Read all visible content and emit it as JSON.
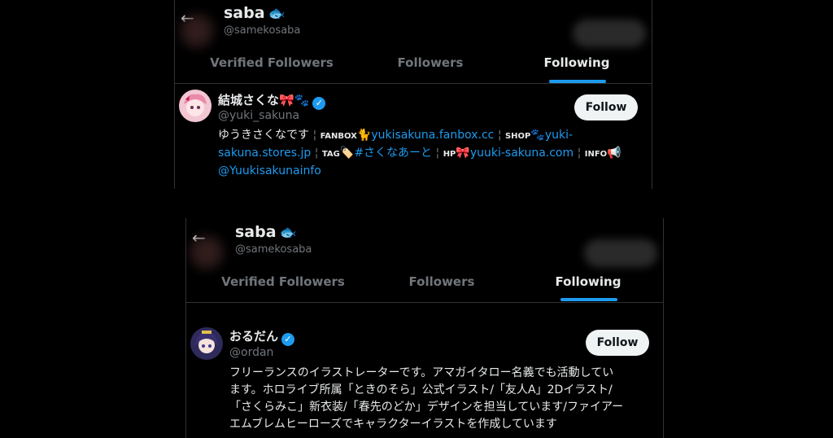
{
  "top": {
    "header": {
      "title": "saba",
      "handle": "@samekosaba",
      "fish_icon": "fish-icon"
    },
    "tabs": [
      {
        "label": "Verified Followers"
      },
      {
        "label": "Followers"
      },
      {
        "label": "Following"
      }
    ],
    "user": {
      "name": "結城さくな",
      "name_emoji": "🎀🐾",
      "handle": "@yuki_sakuna",
      "follow_label": "Follow",
      "bio": {
        "intro": "ゆうきさくなです",
        "fanbox_label": "FANBOX",
        "fanbox_emoji": "🐈",
        "fanbox_link": "yukisakuna.fanbox.cc",
        "shop_label": "SHOP",
        "shop_emoji": "🐾",
        "shop_link": "yuki-sakuna.stores.jp",
        "tag_label": "TAG",
        "tag_emoji": "🏷️",
        "tag_link": "#さくなあーと",
        "hp_label": "HP",
        "hp_emoji": "🎀",
        "hp_link": "yuuki-sakuna.com",
        "info_label": "INFO",
        "info_emoji": "📢",
        "info_link": "@Yuukisakunainfo",
        "sep": "¦"
      }
    }
  },
  "bottom": {
    "header": {
      "title": "saba",
      "handle": "@samekosaba",
      "fish_icon": "fish-icon"
    },
    "tabs": [
      {
        "label": "Verified Followers"
      },
      {
        "label": "Followers"
      },
      {
        "label": "Following"
      }
    ],
    "user": {
      "name": "おるだん",
      "handle": "@ordan",
      "follow_label": "Follow",
      "bio_lines": [
        "フリーランスのイラストレーターです。アマガイタロー名義でも活動してい",
        "ます。ホロライブ所属「ときのそら」公式イラスト/「友人A」2Dイラスト/",
        "「さくらみこ」新衣装/「春先のどか」デザインを担当しています/ファイアー",
        "エムブレムヒーローズでキャラクターイラストを作成しています"
      ]
    }
  },
  "colors": {
    "accent": "#1d9bf0",
    "bg": "#000000",
    "text": "#e7e9ea",
    "muted": "#71767b"
  }
}
